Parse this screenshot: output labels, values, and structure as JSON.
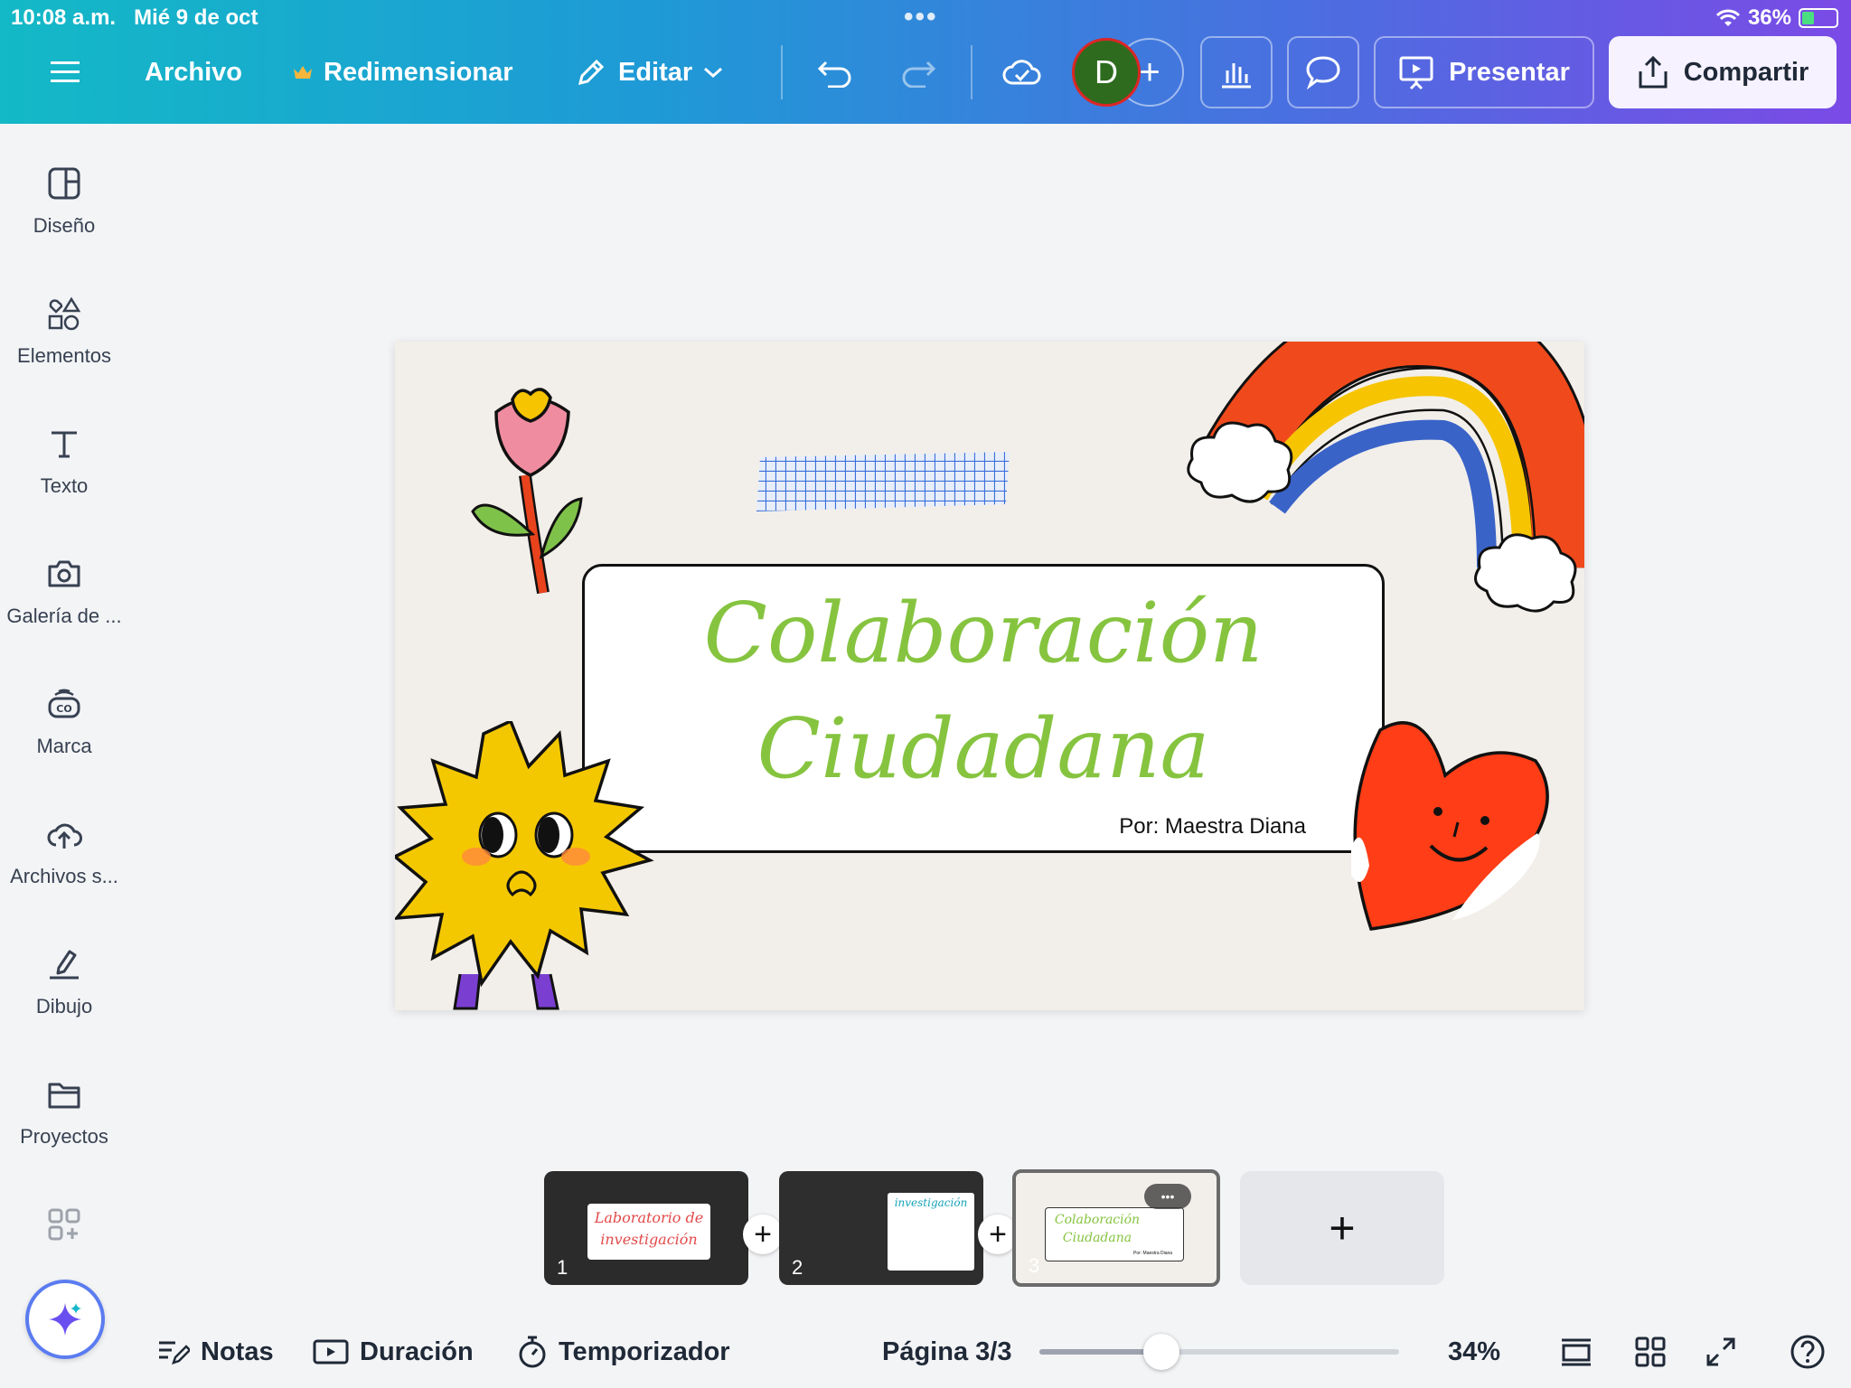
{
  "status": {
    "time": "10:08 a.m.",
    "date": "Mié 9 de oct",
    "battery": "36%",
    "battery_level": 0.36
  },
  "toolbar": {
    "file": "Archivo",
    "resize": "Redimensionar",
    "edit": "Editar",
    "avatar_initial": "D",
    "present": "Presentar",
    "share": "Compartir"
  },
  "sidebar": {
    "items": [
      {
        "label": "Diseño"
      },
      {
        "label": "Elementos"
      },
      {
        "label": "Texto"
      },
      {
        "label": "Galería de ..."
      },
      {
        "label": "Marca"
      },
      {
        "label": "Archivos s..."
      },
      {
        "label": "Dibujo"
      },
      {
        "label": "Proyectos"
      }
    ]
  },
  "slide": {
    "title_line1": "Colaboración",
    "title_line2": "Ciudadana",
    "author": "Por: Maestra Diana"
  },
  "pages": [
    {
      "num": "1",
      "title": "Laboratorio de investigación"
    },
    {
      "num": "2",
      "title": "investigación"
    },
    {
      "num": "3",
      "title": "Colaboración Ciudadana",
      "author": "Por: Maestra Diana"
    }
  ],
  "bottombar": {
    "notes": "Notas",
    "duration": "Duración",
    "timer": "Temporizador",
    "page": "Página 3/3",
    "zoom": "34%",
    "zoom_level": 0.34
  },
  "colors": {
    "accent_green": "#86c440",
    "brand_gradient_start": "#13b9c6",
    "brand_gradient_end": "#7b4ae6"
  }
}
